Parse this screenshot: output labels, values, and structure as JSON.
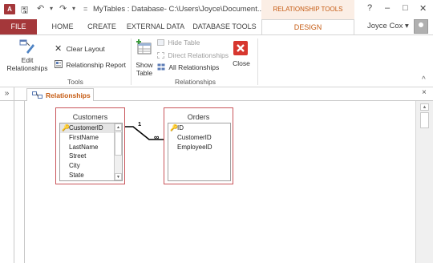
{
  "window": {
    "app_icon": "A",
    "title": "MyTables : Database- C:\\Users\\Joyce\\Document...",
    "contextual_group": "RELATIONSHIP TOOLS",
    "help": "?",
    "minimize": "–",
    "restore": "□",
    "close": "✕"
  },
  "qat": {
    "save": "🖫",
    "undo": "↶",
    "redo": "↷",
    "customize": "="
  },
  "ribbon_tabs": [
    "FILE",
    "HOME",
    "CREATE",
    "EXTERNAL DATA",
    "DATABASE TOOLS"
  ],
  "active_tab": "DESIGN",
  "user": {
    "name": "Joyce Cox",
    "dropdown": "▾"
  },
  "ribbon": {
    "edit_relationships": [
      "Edit",
      "Relationships"
    ],
    "clear_layout": "Clear Layout",
    "relationship_report": "Relationship Report",
    "tools_group": "Tools",
    "show_table": [
      "Show",
      "Table"
    ],
    "hide_table": "Hide Table",
    "direct_relationships": "Direct Relationships",
    "all_relationships": "All Relationships",
    "close": "Close",
    "relationships_group": "Relationships",
    "collapse": "^"
  },
  "document": {
    "nav_toggle": "»",
    "tab_label": "Relationships",
    "close": "×"
  },
  "tables": [
    {
      "name": "Customers",
      "fields": [
        "CustomerID",
        "FirstName",
        "LastName",
        "Street",
        "City",
        "State"
      ],
      "primary_key": "CustomerID"
    },
    {
      "name": "Orders",
      "fields": [
        "ID",
        "CustomerID",
        "EmployeeID"
      ],
      "primary_key": "ID"
    }
  ],
  "relationship": {
    "one_side": "1",
    "many_side": "∞"
  },
  "colors": {
    "access_brand": "#a4373a",
    "contextual_accent": "#c55a11",
    "table_border": "#c8555a",
    "key_icon": "#d49a00"
  }
}
